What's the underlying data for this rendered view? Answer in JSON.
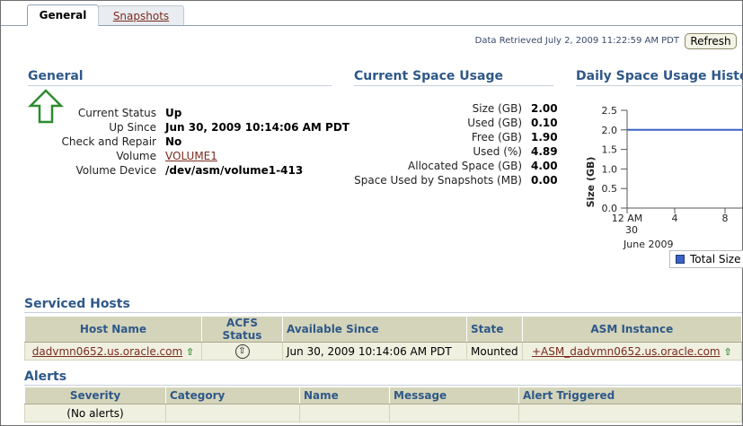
{
  "tabs": [
    {
      "label": "General",
      "active": true
    },
    {
      "label": "Snapshots",
      "active": false
    }
  ],
  "header": {
    "data_retrieved": "Data Retrieved July 2, 2009 11:22:59 AM PDT",
    "refresh_label": "Refresh"
  },
  "general": {
    "title": "General",
    "status_icon": "up-arrow-icon",
    "rows": [
      {
        "label": "Current Status",
        "value": "Up"
      },
      {
        "label": "Up Since",
        "value": "Jun 30, 2009 10:14:06 AM PDT"
      },
      {
        "label": "Check and Repair",
        "value": "No"
      },
      {
        "label": "Volume",
        "value": "VOLUME1"
      },
      {
        "label": "Volume Device",
        "value": "/dev/asm/volume1-413"
      }
    ]
  },
  "space_usage": {
    "title": "Current Space Usage",
    "rows": [
      {
        "label": "Size (GB)",
        "value": "2.00"
      },
      {
        "label": "Used (GB)",
        "value": "0.10"
      },
      {
        "label": "Free (GB)",
        "value": "1.90"
      },
      {
        "label": "Used (%)",
        "value": "4.89"
      },
      {
        "label": "Allocated Space (GB)",
        "value": "4.00"
      },
      {
        "label": "Space Used by Snapshots (MB)",
        "value": "0.00"
      }
    ]
  },
  "history": {
    "title": "Daily Space Usage History",
    "legend_label": "Total Size",
    "line_color": "#3b62c4"
  },
  "chart_data": {
    "type": "line",
    "ylabel": "Size (GB)",
    "ylim": [
      0,
      2.5
    ],
    "yticks": [
      "2.5",
      "2.0",
      "1.5",
      "1.0",
      "0.5",
      "0.0"
    ],
    "xticks": [
      "12 AM",
      "4",
      "8"
    ],
    "xsub": [
      "30",
      "June 2009"
    ],
    "series": [
      {
        "name": "Total Size",
        "x": [
          "12 AM",
          "4",
          "8"
        ],
        "values": [
          2.0,
          2.0,
          2.0
        ]
      }
    ]
  },
  "serviced_hosts": {
    "title": "Serviced Hosts",
    "columns": [
      "Host Name",
      "ACFS Status",
      "Available Since",
      "State",
      "ASM Instance"
    ],
    "rows": [
      {
        "host": "dadvmn0652.us.oracle.com",
        "acfs_status_icon": "up-status-icon",
        "available_since": "Jun 30, 2009 10:14:06 AM PDT",
        "state": "Mounted",
        "asm_instance": "+ASM_dadvmn0652.us.oracle.com"
      }
    ]
  },
  "alerts": {
    "title": "Alerts",
    "columns": [
      "Severity",
      "Category",
      "Name",
      "Message",
      "Alert Triggered"
    ],
    "empty_text": "(No alerts)"
  }
}
